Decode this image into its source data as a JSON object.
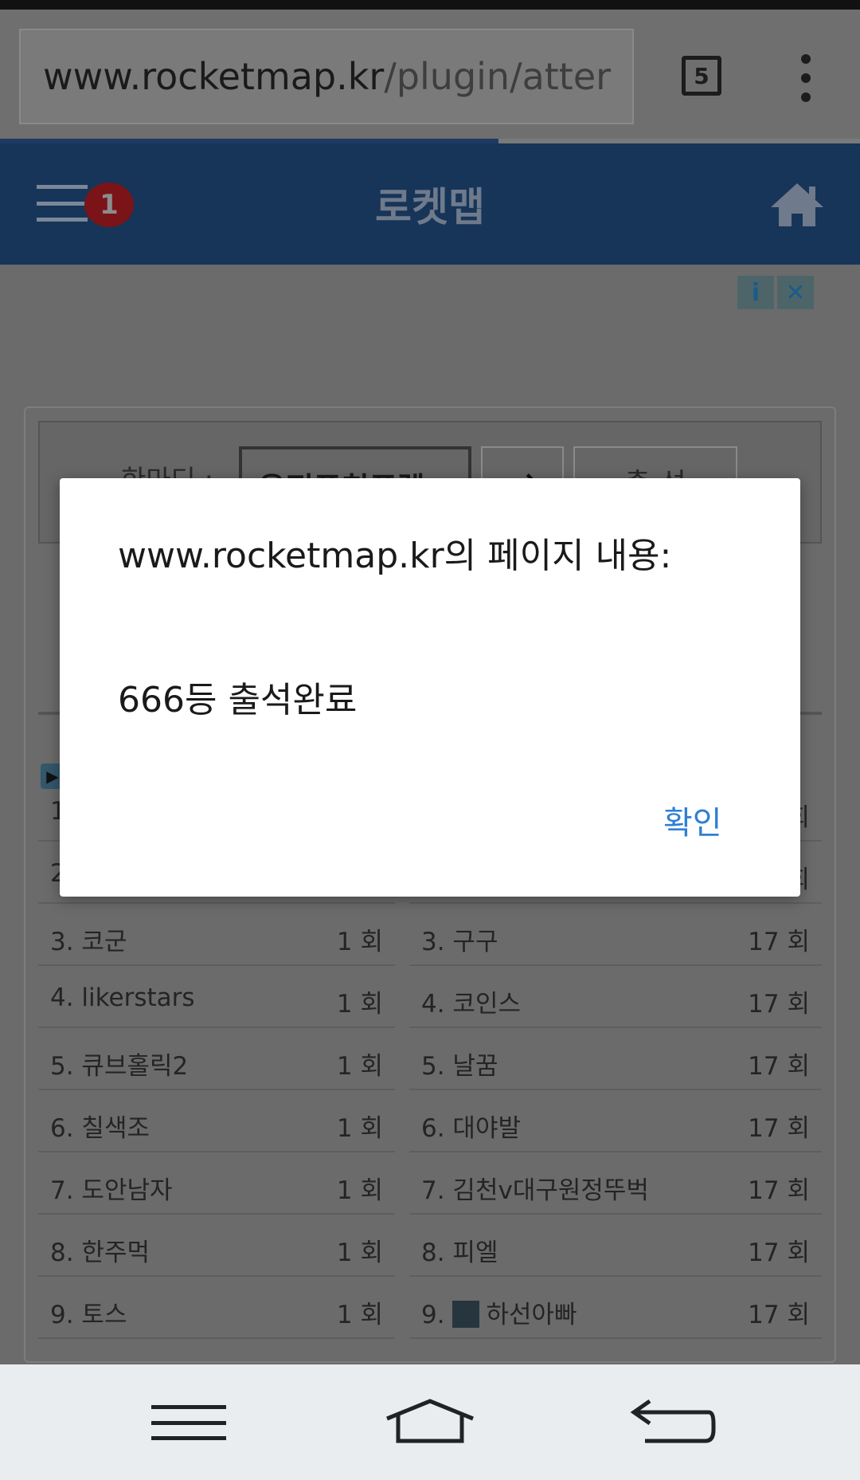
{
  "browser": {
    "url_host": "www.rocketmap.kr",
    "url_path": "/plugin/atter",
    "tab_count": "5",
    "load_progress": 0.58
  },
  "header": {
    "title": "로켓맵",
    "notification_count": "1"
  },
  "ad": {
    "info_icon": "i",
    "close_icon": "✕"
  },
  "form": {
    "label": "한마디 :",
    "input_value": "운전푸칭푸렐",
    "arrow_label": "→",
    "attend_button": "출 석"
  },
  "ranking": {
    "marker": "▶",
    "left": [
      {
        "name": "1.",
        "count": ""
      },
      {
        "name": "2.",
        "count": ""
      },
      {
        "name": "3. 코군",
        "count": "1 회"
      },
      {
        "name": "4. likerstars",
        "count": "1 회"
      },
      {
        "name": "5. 큐브홀릭2",
        "count": "1 회"
      },
      {
        "name": "6. 칠색조",
        "count": "1 회"
      },
      {
        "name": "7. 도안남자",
        "count": "1 회"
      },
      {
        "name": "8. 한주먹",
        "count": "1 회"
      },
      {
        "name": "9. 토스",
        "count": "1 회"
      }
    ],
    "right": [
      {
        "name": "",
        "count": "회"
      },
      {
        "name": "",
        "count": "회"
      },
      {
        "name": "3. 구구",
        "count": "17 회"
      },
      {
        "name": "4. 코인스",
        "count": "17 회"
      },
      {
        "name": "5. 날꿈",
        "count": "17 회"
      },
      {
        "name": "6. 대야발",
        "count": "17 회"
      },
      {
        "name": "7. 김천v대구원정뚜벅",
        "count": "17 회"
      },
      {
        "name": "8. 피엘",
        "count": "17 회"
      },
      {
        "name": "9.",
        "suffix": "하선아빠",
        "count": "17 회"
      }
    ]
  },
  "dialog": {
    "title": "www.rocketmap.kr의 페이지 내용:",
    "message": "666등 출석완료",
    "ok_label": "확인"
  },
  "icons": {
    "menu": "hamburger-icon",
    "home": "home-icon",
    "back": "back-icon",
    "overflow": "more-vert-icon"
  },
  "colors": {
    "header_bg": "#163558",
    "dialog_button": "#2f7fd3",
    "badge": "#7a1418"
  }
}
